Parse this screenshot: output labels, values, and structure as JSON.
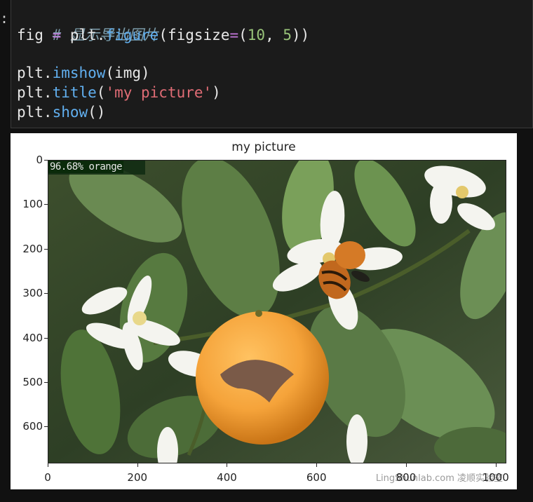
{
  "prompt_marker": ":",
  "code": {
    "line1_comment": "# 显示导出图片",
    "line2": {
      "a": "fig ",
      "op": "=",
      "b": " plt.",
      "fn": "figure",
      "c": "(figsize",
      "op2": "=",
      "d": "(",
      "n1": "10",
      "e": ", ",
      "n2": "5",
      "f": "))"
    },
    "line4": {
      "a": "plt.",
      "fn": "imshow",
      "b": "(img)"
    },
    "line5": {
      "a": "plt.",
      "fn": "title",
      "b": "(",
      "s": "'my picture'",
      "c": ")"
    },
    "line6": {
      "a": "plt.",
      "fn": "show",
      "b": "()"
    }
  },
  "figure": {
    "title": "my picture",
    "overlay_label": "96.68% orange",
    "y_ticks": [
      "0",
      "100",
      "200",
      "300",
      "400",
      "500",
      "600"
    ],
    "x_ticks": [
      "0",
      "200",
      "400",
      "600",
      "800",
      "1000"
    ],
    "image_width": 1024,
    "image_height": 683
  },
  "watermark": "LingShunlab.com 凌顺实验室",
  "colors": {
    "code_bg": "#1b1b1b",
    "page_bg": "#111111",
    "comment": "#7a9aa8",
    "keyword": "#c678dd",
    "function": "#61afef",
    "number": "#98c379",
    "string": "#e06c75"
  }
}
